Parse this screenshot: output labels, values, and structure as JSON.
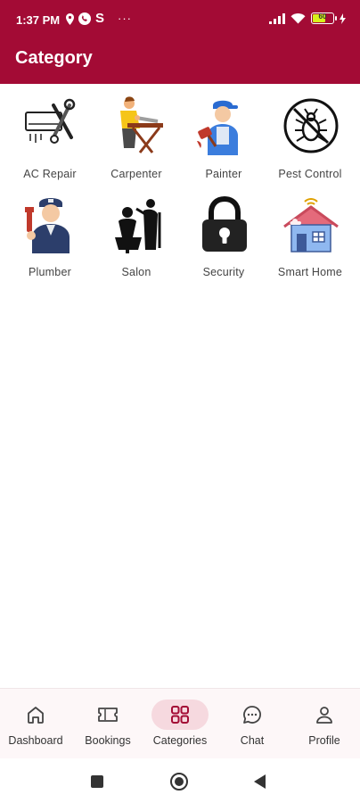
{
  "status_bar": {
    "time": "1:37 PM",
    "extra_icon": "S",
    "overflow": "···",
    "battery_level": "60"
  },
  "app_bar": {
    "title": "Category"
  },
  "categories": [
    {
      "label": "AC Repair",
      "icon": "ac-repair-icon"
    },
    {
      "label": "Carpenter",
      "icon": "carpenter-icon"
    },
    {
      "label": "Painter",
      "icon": "painter-icon"
    },
    {
      "label": "Pest Control",
      "icon": "pest-control-icon"
    },
    {
      "label": "Plumber",
      "icon": "plumber-icon"
    },
    {
      "label": "Salon",
      "icon": "salon-icon"
    },
    {
      "label": "Security",
      "icon": "security-lock-icon"
    },
    {
      "label": "Smart Home",
      "icon": "smart-home-icon"
    }
  ],
  "bottom_nav": {
    "active": "Categories",
    "items": [
      {
        "label": "Dashboard",
        "icon": "home-icon"
      },
      {
        "label": "Bookings",
        "icon": "ticket-icon"
      },
      {
        "label": "Categories",
        "icon": "grid-icon"
      },
      {
        "label": "Chat",
        "icon": "chat-bubble-icon"
      },
      {
        "label": "Profile",
        "icon": "person-icon"
      }
    ]
  },
  "colors": {
    "primary": "#a30b35",
    "active_pill": "#f6d9df",
    "nav_background": "#fdf7f8",
    "label_text": "#444444"
  }
}
